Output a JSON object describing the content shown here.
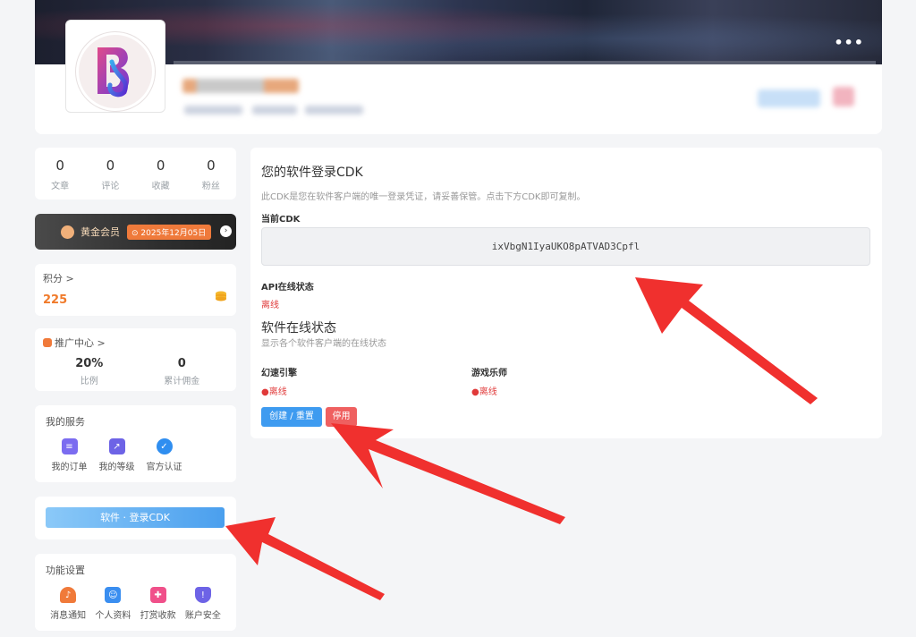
{
  "header": {
    "more_icon": "more-dots-icon"
  },
  "stats": [
    {
      "value": "0",
      "label": "文章"
    },
    {
      "value": "0",
      "label": "评论"
    },
    {
      "value": "0",
      "label": "收藏"
    },
    {
      "value": "0",
      "label": "粉丝"
    }
  ],
  "vip": {
    "label": "黄金会员",
    "date": "⊙ 2025年12月05日"
  },
  "points": {
    "title": "积分 >",
    "value": "225"
  },
  "promo": {
    "title": "推广中心 >",
    "ratio_value": "20%",
    "ratio_label": "比例",
    "commission_value": "0",
    "commission_label": "累计佣金"
  },
  "services": {
    "title": "我的服务",
    "items": [
      {
        "label": "我的订单",
        "icon": "order-icon",
        "color": "#7b6cf0"
      },
      {
        "label": "我的等级",
        "icon": "level-icon",
        "color": "#6d63e6"
      },
      {
        "label": "官方认证",
        "icon": "verified-icon",
        "color": "#2f8ef0"
      }
    ]
  },
  "cdk_button": "软件 · 登录CDK",
  "functions": {
    "title": "功能设置",
    "items": [
      {
        "label": "消息通知",
        "icon": "bell-icon",
        "color": "#f07a3a"
      },
      {
        "label": "个人资料",
        "icon": "profile-icon",
        "color": "#3a8ef0"
      },
      {
        "label": "打赏收款",
        "icon": "gift-icon",
        "color": "#f0508a"
      },
      {
        "label": "账户安全",
        "icon": "shield-icon",
        "color": "#6d63e6"
      }
    ]
  },
  "main": {
    "title": "您的软件登录CDK",
    "subtitle": "此CDK是您在软件客户端的唯一登录凭证，请妥善保管。点击下方CDK即可复制。",
    "cdk_label": "当前CDK",
    "cdk_value": "ixVbgN1IyaUKO8pATVAD3Cpfl",
    "api_label": "API在线状态",
    "api_status": "离线",
    "online_title": "软件在线状态",
    "online_sub": "显示各个软件客户端的在线状态",
    "apps": [
      {
        "name": "幻速引擎",
        "status": "●离线"
      },
      {
        "name": "游戏乐师",
        "status": "●离线"
      }
    ],
    "create_button": "创建 / 重置",
    "disable_button": "停用"
  },
  "colors": {
    "accent_blue": "#3e9bf0",
    "danger_red": "#ef6060",
    "points_orange": "#f07a2a",
    "arrow_red": "#f0302e"
  }
}
